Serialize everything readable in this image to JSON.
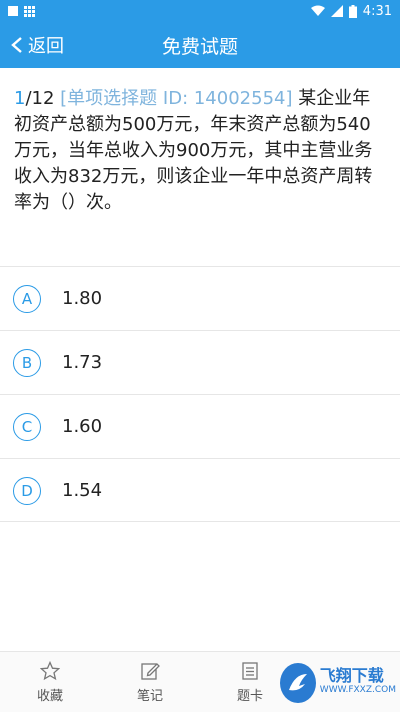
{
  "status_bar": {
    "time": "4:31"
  },
  "header": {
    "back_label": "返回",
    "title": "免费试题"
  },
  "question": {
    "number": "1",
    "total": "/12",
    "tag": "[单项选择题 ID: 14002554]",
    "text": "某企业年初资产总额为500万元，年末资产总额为540万元，当年总收入为900万元，其中主营业务收入为832万元，则该企业一年中总资产周转率为（）次。"
  },
  "options": [
    {
      "letter": "A",
      "text": "1.80"
    },
    {
      "letter": "B",
      "text": "1.73"
    },
    {
      "letter": "C",
      "text": "1.60"
    },
    {
      "letter": "D",
      "text": "1.54"
    }
  ],
  "bottom_tabs": {
    "favorite": "收藏",
    "notes": "笔记",
    "answer_card": "题卡"
  },
  "watermark": {
    "main": "飞翔下载",
    "sub": "WWW.FXXZ.COM"
  },
  "colors": {
    "accent": "#2b9be6"
  }
}
